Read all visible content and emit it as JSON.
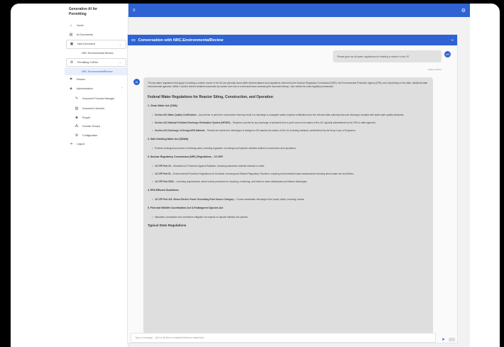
{
  "app": {
    "title": "Generative AI for Permitting"
  },
  "sidebar": {
    "items": [
      {
        "icon": "home-icon",
        "label": "Home"
      },
      {
        "icon": "list-icon",
        "label": "AI Documents"
      },
      {
        "icon": "file-icon",
        "label": "New Document"
      },
      {
        "icon": "doc-icon",
        "label": "NRC Environmental Review"
      },
      {
        "icon": "settings-icon",
        "label": "Permitting CoPilot"
      },
      {
        "icon": "doc-icon",
        "label": "NRC EnvironmentalReview"
      },
      {
        "icon": "flag-icon",
        "label": "Review"
      },
      {
        "icon": "admin-icon",
        "label": "Administration"
      },
      {
        "icon": "wrench-icon",
        "label": "Document Process Manager"
      },
      {
        "icon": "library-icon",
        "label": "Document Libraries"
      },
      {
        "icon": "people-icon",
        "label": "People"
      },
      {
        "icon": "group-icon",
        "label": "Domain Groups"
      },
      {
        "icon": "config-icon",
        "label": "Configuration"
      },
      {
        "icon": "logout-icon",
        "label": "Logout"
      }
    ]
  },
  "conversation": {
    "title": "Conversation with NRC.EnvironmentalReview",
    "user_avatar": "UR",
    "user_message": "Please give me all water regulations for building a reactor in the US",
    "timestamp": "Today at 09:11",
    "bot_avatar": "AI",
    "intro": "The key water regulations that apply to building a nuclear reactor in the US are primarily found within federal statutes and regulations enforced by the Nuclear Regulatory Commission (NRC), the Environmental Protection Agency (EPA), and, depending on the state, additional state environmental agencies. While I couldn't retrieve detailed summaries by section here due to a technical issue accessing the document library, I can outline the main regulatory framework:",
    "heading": "Federal Water Regulations for Reactor Siting, Construction, and Operation",
    "sections": [
      {
        "title": "1. Clean Water Act (CWA)",
        "items": [
          {
            "bold": "Section 401 Water Quality Certification",
            "text": " – Any license or permit for construction that may result in a discharge to navigable waters requires certification from the relevant state authority that such discharge complies with state water quality standards."
          },
          {
            "bold": "Section 402 National Pollutant Discharge Elimination System (NPDES)",
            "text": " – Requires a permit for any discharge of pollutants from a point source into waters of the US, typically administered by the EPA or state agencies."
          },
          {
            "bold": "Section 404 Discharge of Dredged/Fill Material",
            "text": " – Permits are needed for discharges of dredged or fill material into waters of the US, including wetlands, administered by the Army Corps of Engineers."
          }
        ]
      },
      {
        "title": "2. Safe Drinking Water Act (SDWA)",
        "items": [
          {
            "bold": "",
            "text": "Protects underground sources of drinking water, including regulation of underground injection activities related to construction and operations."
          }
        ]
      },
      {
        "title": "3. Nuclear Regulatory Commission (NRC) Regulations – 10 CFR",
        "items": [
          {
            "bold": "10 CFR Part 20",
            "text": " – Standards for Protection Against Radiation, including radioactive material released to water."
          },
          {
            "bold": "10 CFR Part 51",
            "text": " – Environmental Protection Regulations for Domestic Licensing and Related Regulatory Functions, requiring environmental impact assessments including about water use and effects."
          },
          {
            "bold": "10 CFR Part 50/52",
            "text": " – Licensing requirements, which include provisions for reporting, monitoring, and limits for water withdrawals and effluent discharges."
          }
        ]
      },
      {
        "title": "4. EPA Effluent Guidelines",
        "items": [
          {
            "bold": "40 CFR Part 423: Steam Electric Power Generating Point Source Category",
            "text": " – Covers wastewater discharges from power plants, including nuclear."
          }
        ]
      },
      {
        "title": "5. Fish and Wildlife Coordination Act & Endangered Species Act",
        "items": [
          {
            "bold": "",
            "text": "Mandates consultation and sometimes mitigation for impacts on aquatic habitats and species."
          }
        ]
      }
    ],
    "subheading": "Typical State Regulations",
    "input_placeholder": "Type a message... (@ for @ files to reattach/reference attached)"
  }
}
